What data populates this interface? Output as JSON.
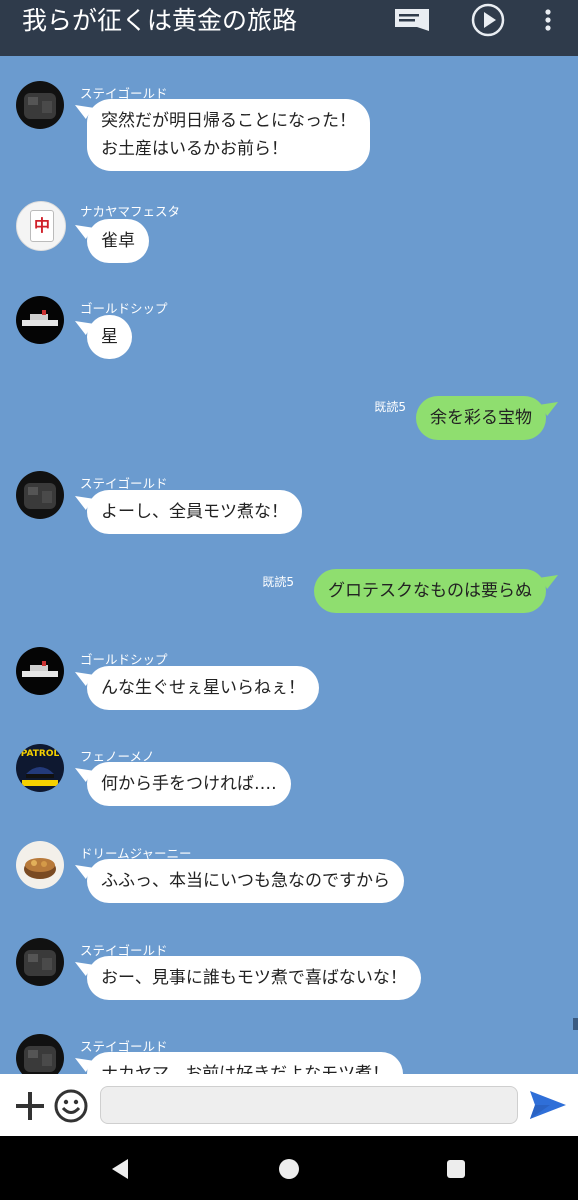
{
  "header": {
    "title": "我らが征くは黄金の旅路",
    "icons": [
      "notes-icon",
      "play-icon",
      "more-vertical-icon"
    ]
  },
  "messages": [
    {
      "type": "incoming",
      "sender": "ステイゴールド",
      "avatar": "stay-gold-avatar",
      "lines": [
        "突然だが明日帰ることになった！",
        "お土産はいるかお前ら！"
      ]
    },
    {
      "type": "incoming",
      "sender": "ナカヤマフェスタ",
      "avatar": "mahjong-tile-avatar",
      "avatar_text": "中",
      "lines": [
        "雀卓"
      ]
    },
    {
      "type": "incoming",
      "sender": "ゴールドシップ",
      "avatar": "ship-avatar",
      "lines": [
        "星"
      ]
    },
    {
      "type": "outgoing",
      "read": "既読5",
      "lines": [
        "余を彩る宝物"
      ]
    },
    {
      "type": "incoming",
      "sender": "ステイゴールド",
      "avatar": "stay-gold-avatar",
      "lines": [
        "よーし、全員モツ煮な！"
      ]
    },
    {
      "type": "outgoing",
      "read": "既読5",
      "lines": [
        "グロテスクなものは要らぬ"
      ]
    },
    {
      "type": "incoming",
      "sender": "ゴールドシップ",
      "avatar": "ship-avatar",
      "lines": [
        "んな生ぐせぇ星いらねぇ！"
      ]
    },
    {
      "type": "incoming",
      "sender": "フェノーメノ",
      "avatar": "patrol-avatar",
      "avatar_text": "PATROL",
      "lines": [
        "何から手をつければ‥‥"
      ]
    },
    {
      "type": "incoming",
      "sender": "ドリームジャーニー",
      "avatar": "food-bowl-avatar",
      "lines": [
        "ふふっ、本当にいつも急なのですから"
      ]
    },
    {
      "type": "incoming",
      "sender": "ステイゴールド",
      "avatar": "stay-gold-avatar",
      "lines": [
        "おー、見事に誰もモツ煮で喜ばないな！"
      ]
    },
    {
      "type": "incoming",
      "sender": "ステイゴールド",
      "avatar": "stay-gold-avatar",
      "lines": [
        "ナカヤマ、お前は好きだよなモツ煮！"
      ]
    }
  ],
  "input": {
    "placeholder": "",
    "value": ""
  },
  "colors": {
    "header": "#2f3b4b",
    "chat_bg": "#6b9bcf",
    "outgoing_bubble": "#8fde6f",
    "incoming_bubble": "#ffffff",
    "send": "#2f6fd8"
  }
}
